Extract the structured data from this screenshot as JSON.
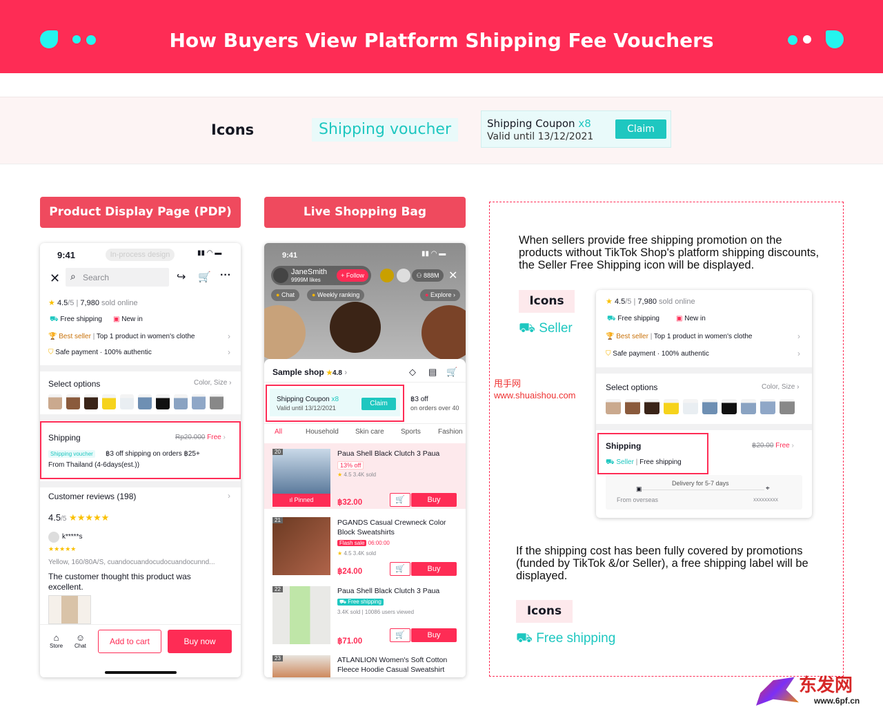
{
  "banner": {
    "title": "How Buyers View Platform Shipping Fee Vouchers"
  },
  "legend": {
    "icons_label": "Icons",
    "voucher_label": "Shipping voucher",
    "coupon_title": "Shipping Coupon",
    "coupon_multiplier": "x8",
    "coupon_valid": "Valid until 13/12/2021",
    "claim_label": "Claim"
  },
  "sections": {
    "pdp": "Product Display Page (PDP)",
    "live": "Live Shopping Bag"
  },
  "pdp": {
    "time": "9:41",
    "status_label": "In-process design",
    "search_placeholder": "Search",
    "rating": "4.5",
    "rating_max": "/5",
    "sold": "7,980",
    "sold_suffix": "sold online",
    "free_shipping": "Free shipping",
    "new_in": "New in",
    "best_seller": "Best seller",
    "top_product": "Top 1 product in women's clothe",
    "safe_payment": "Safe payment · 100% authentic",
    "select_options": "Select options",
    "color_size": "Color, Size",
    "shipping": "Shipping",
    "shipping_old_price": "Rp20.000",
    "shipping_free": "Free",
    "voucher_tag": "Shipping voucher",
    "voucher_text": "฿3 off shipping on orders ฿25+",
    "from": "From Thailand (4-6days(est.))",
    "reviews_title": "Customer reviews (198)",
    "reviews_rating": "4.5",
    "reviews_max": "/5",
    "reviewer": "k*****s",
    "review_variant": "Yellow, 160/80A/S, cuandocuandocudocuandocunnd...",
    "review_text": "The customer thought this product was excellent.",
    "store": "Store",
    "chat": "Chat",
    "add_to_cart": "Add to cart",
    "buy_now": "Buy now"
  },
  "live": {
    "time": "9:41",
    "host": "JaneSmith",
    "likes": "9999M likes",
    "follow": "+ Follow",
    "viewers": "888M",
    "chat": "Chat",
    "weekly": "Weekly ranking",
    "explore": "Explore",
    "shop": "Sample shop",
    "shop_rating": "4.8",
    "coupon_title": "Shipping Coupon",
    "coupon_multiplier": "x8",
    "coupon_valid": "Valid until 13/12/2021",
    "claim": "Claim",
    "coupon2_title": "฿3 off",
    "coupon2_sub": "on orders over 40",
    "tabs": [
      "All",
      "Household",
      "Skin care",
      "Sports",
      "Fashion"
    ],
    "products": [
      {
        "num": "20",
        "name": "Paua Shell Black Clutch 3 Paua",
        "tag": "13% off",
        "rating": "4.5",
        "sold": "3.4K sold",
        "price": "฿32.00",
        "pinned": "Pinned",
        "buy": "Buy"
      },
      {
        "num": "21",
        "name": "PGANDS Casual Crewneck Color Block Sweatshirts",
        "tag": "Flash sale",
        "timer": "06:00:00",
        "rating": "4.5",
        "sold": "3.4K sold",
        "price": "฿24.00",
        "buy": "Buy"
      },
      {
        "num": "22",
        "name": "Paua Shell Black Clutch 3 Paua",
        "tag": "Free shipping",
        "sold": "3.4K sold",
        "viewed": "10086 users viewed",
        "price": "฿71.00",
        "buy": "Buy"
      },
      {
        "num": "23",
        "name": "ATLANLION Women's Soft Cotton Fleece Hoodie Casual Sweatshirt"
      }
    ]
  },
  "right": {
    "para1": "When sellers provide free shipping promotion on the products without TikTok Shop's platform shipping discounts, the Seller Free Shipping icon will be displayed.",
    "icons1": "Icons",
    "seller_label": "Seller",
    "card": {
      "rating": "4.5",
      "rating_max": "/5",
      "sold": "7,980",
      "sold_suffix": "sold online",
      "free_shipping": "Free shipping",
      "new_in": "New in",
      "best_seller": "Best seller",
      "top_product": "Top 1 product in women's clothe",
      "safe_payment": "Safe payment · 100% authentic",
      "select_options": "Select options",
      "color_size": "Color, Size",
      "shipping": "Shipping",
      "old_price": "฿20.00",
      "free": "Free",
      "seller": "Seller",
      "free_shipping2": "Free shipping",
      "delivery": "Delivery for 5-7 days",
      "from": "From overseas",
      "dest": "xxxxxxxxx"
    },
    "para2": "If the shipping cost has been fully covered by promotions (funded by TikTok &/or Seller), a free shipping label will be displayed.",
    "icons2": "Icons",
    "free_label": "Free shipping"
  },
  "watermark": {
    "cn": "甩手网",
    "url": "www.shuaishou.com",
    "brand_cn": "东发网",
    "brand_url": "www.6pf.cn"
  },
  "colors": {
    "brand": "#fe2c55",
    "teal": "#1ec7c0",
    "header": "#ef4a5e"
  }
}
